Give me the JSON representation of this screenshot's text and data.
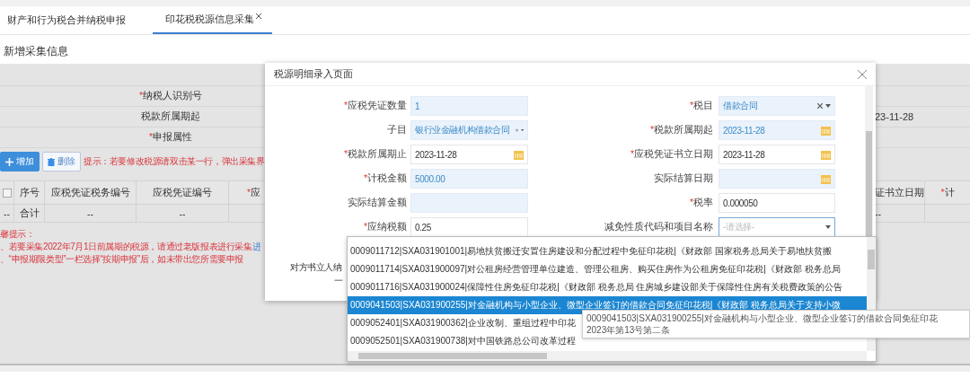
{
  "tabs": [
    {
      "label": "财产和行为税合并纳税申报",
      "selected": false,
      "closable": false
    },
    {
      "label": "印花税税源信息采集",
      "selected": true,
      "closable": true
    }
  ],
  "section_title": "新增采集信息",
  "background_form": {
    "rows": [
      {
        "label": "纳税人识别号",
        "required_mark": "*"
      },
      {
        "label": "税款所属期起",
        "value": "23-11-28"
      },
      {
        "label": "申报属性",
        "required_mark": "*"
      }
    ]
  },
  "toolbar": {
    "buttons": [
      {
        "label": "增加",
        "kind": "primary"
      },
      {
        "label": "删除",
        "kind": "delete"
      }
    ],
    "hint": "提示：若要修改税源请双击某一行，弹出采集界"
  },
  "table": {
    "select_all_checked": false,
    "left_columns": [
      {
        "label": "序号"
      },
      {
        "label": "应税凭证税务编号"
      },
      {
        "label": "应税凭证编号"
      },
      {
        "label": "应",
        "required_mark": "*"
      }
    ],
    "right_columns": [
      {
        "label": "证书立日期"
      },
      {
        "label": "计",
        "required_mark": "*"
      }
    ],
    "total_row": {
      "left_cells": [
        "--",
        "合计",
        "--",
        "--"
      ],
      "right_cells": [
        "--"
      ]
    }
  },
  "notice": {
    "title": "馨提示：",
    "lines": [
      {
        "text": "、若要采集2022年7月1日前属期的税源，请通过老版报表进行采集",
        "link": "进"
      },
      {
        "text": "、“申报期限类型”一栏选择“按期申报”后，如未带出您所需要申报"
      }
    ]
  },
  "modal": {
    "title": "税源明细录入页面",
    "fields": [
      {
        "label": "应税凭证数量",
        "required_mark": "*",
        "kind": "text",
        "value": "1",
        "readonly": true,
        "focused": false
      },
      {
        "label": "税目",
        "required_mark": "*",
        "kind": "select",
        "value": "借款合同",
        "readonly": true,
        "focused": false
      },
      {
        "label": "子目",
        "kind": "select",
        "value": "银行业金融机构借款合同",
        "readonly": true,
        "focused": false
      },
      {
        "label": "税款所属期起",
        "required_mark": "*",
        "kind": "date",
        "value": "2023-11-28",
        "readonly": true,
        "focused": false
      },
      {
        "label": "税款所属期止",
        "required_mark": "*",
        "kind": "date",
        "value": "2023-11-28",
        "readonly": false,
        "focused": false
      },
      {
        "label": "应税凭证书立日期",
        "required_mark": "*",
        "kind": "date",
        "value": "2023-11-28",
        "readonly": false,
        "focused": false
      },
      {
        "label": "计税金额",
        "required_mark": "*",
        "kind": "text",
        "value": "5000.00",
        "readonly": true,
        "focused": false
      },
      {
        "label": "实际结算日期",
        "kind": "date",
        "readonly": true,
        "focused": false
      },
      {
        "label": "实际结算金额",
        "kind": "text",
        "readonly": true,
        "focused": false
      },
      {
        "label": "税率",
        "required_mark": "*",
        "kind": "text",
        "value": "0.000050",
        "readonly": false,
        "focused": false
      },
      {
        "label": "应纳税额",
        "required_mark": "*",
        "kind": "text",
        "value": "0.25",
        "readonly": false,
        "focused": false
      },
      {
        "label": "减免性质代码和项目名称",
        "kind": "select",
        "placeholder": "-请选择-",
        "readonly": false,
        "focused": true
      }
    ],
    "covered_labels": [
      "对方书立人纳",
      "一"
    ]
  },
  "dropdown": {
    "options": [
      {
        "text": "0009011712|SXA031901001|易地扶贫搬迁安置住房建设和分配过程中免征印花税|《财政部 国家税务总局关于易地扶贫搬",
        "selected": false
      },
      {
        "text": "0009011714|SXA031900097|对公租房经营管理单位建造、管理公租房、购买住房作为公租房免征印花税|《财政部 税务总局",
        "selected": false
      },
      {
        "text": "0009011716|SXA031900024|保障性住房免征印花税|《财政部 税务总局 住房城乡建设部关于保障性住房有关税费政策的公告",
        "selected": false
      },
      {
        "text": "0009041503|SXA031900255|对金融机构与小型企业、微型企业签订的借款合同免征印花税|《财政部 税务总局关于支持小微",
        "selected": true
      },
      {
        "text": "0009052401|SXA031900362|企业改制、重组过程中印花",
        "selected": false
      },
      {
        "text": "0009052501|SXA031900738|对中国铁路总公司改革过程",
        "selected": false
      }
    ]
  },
  "tooltip": {
    "lines": [
      "0009041503|SXA031900255|对金融机构与小型企业、微型企业签订的借款合同免征印花",
      "2023年第13号第二条"
    ]
  }
}
